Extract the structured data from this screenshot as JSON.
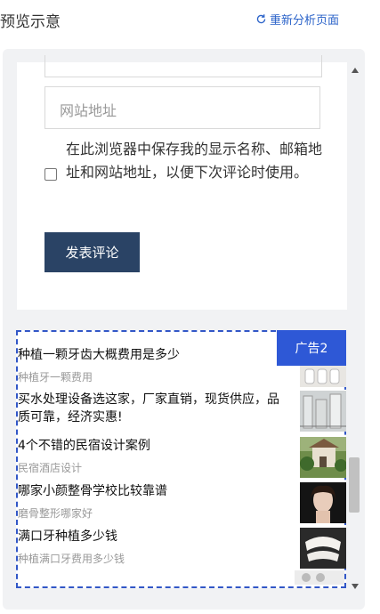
{
  "header": {
    "title": "预览示意",
    "reload_label": "重新分析页面"
  },
  "comment_form": {
    "url_placeholder": "网站地址",
    "cookie_consent_label": "在此浏览器中保存我的显示名称、邮箱地址和网站地址，以便下次评论时使用。",
    "submit_label": "发表评论"
  },
  "ad": {
    "badge": "广告2",
    "items": [
      {
        "title": "种植一颗牙齿大概费用是多少",
        "subtitle": "种植牙一颗费用",
        "thumb": "teeth-implant-image"
      },
      {
        "title": "买水处理设备选这家，厂家直销，现货供应，品质可靠，经济实惠!",
        "subtitle": "",
        "thumb": "water-equipment-image"
      },
      {
        "title": "4个不错的民宿设计案例",
        "subtitle": "民宿酒店设计",
        "thumb": "guesthouse-image"
      },
      {
        "title": "哪家小颜整骨学校比较靠谱",
        "subtitle": "磨骨整形哪家好",
        "thumb": "face-portrait-image"
      },
      {
        "title": "满口牙种植多少钱",
        "subtitle": "种植满口牙费用多少钱",
        "thumb": "full-dentures-image"
      }
    ]
  }
}
